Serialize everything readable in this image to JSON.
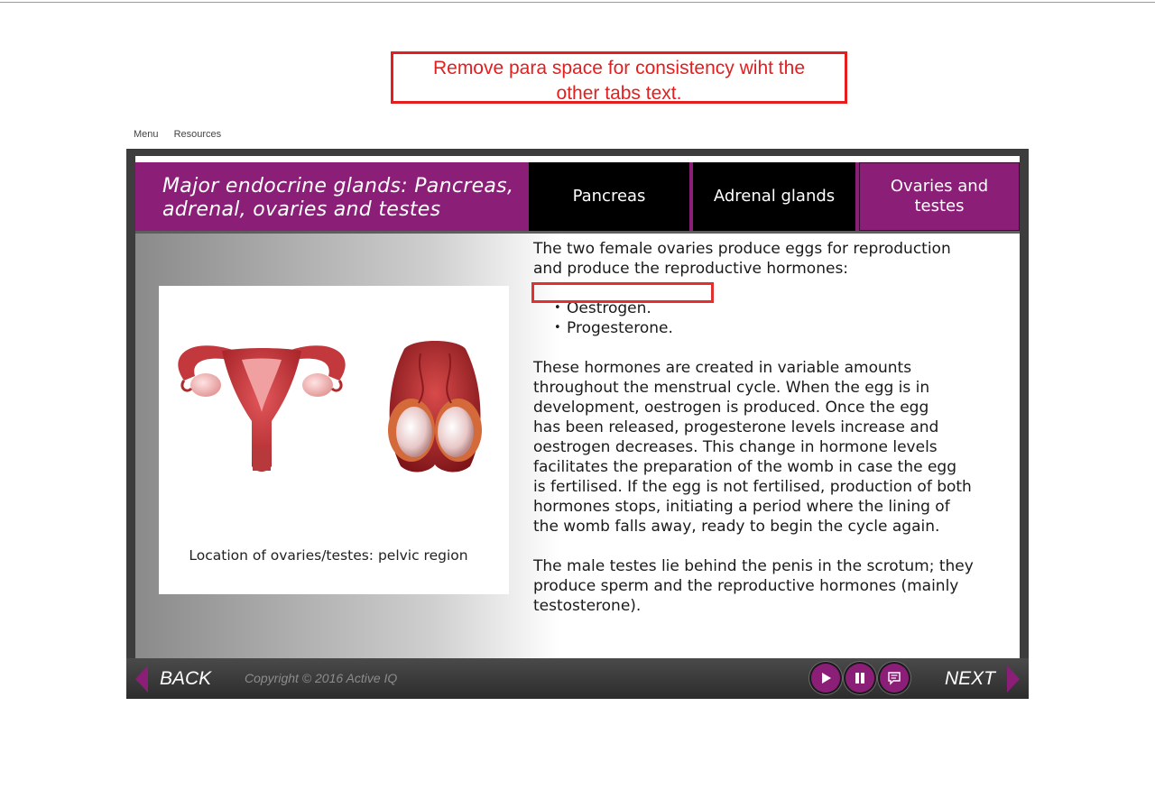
{
  "annotation": {
    "line1": "Remove para space for consistency wiht the",
    "line2": "other tabs text."
  },
  "topnav": {
    "menu": "Menu",
    "resources": "Resources"
  },
  "header": {
    "title_line1": "Major endocrine glands: Pancreas,",
    "title_line2": "adrenal, ovaries and testes",
    "tabs": [
      {
        "label": "Pancreas"
      },
      {
        "label": "Adrenal glands"
      },
      {
        "label_line1": "Ovaries and",
        "label_line2": "testes"
      }
    ]
  },
  "image": {
    "caption": "Location of ovaries/testes: pelvic region"
  },
  "content": {
    "intro_line1": "The two female ovaries produce eggs for reproduction",
    "intro_line2": "and produce the reproductive hormones:",
    "bullets": [
      "Oestrogen.",
      "Progesterone."
    ],
    "para2": [
      "These hormones are created in variable amounts",
      "throughout the menstrual cycle. When the egg is in",
      "development, oestrogen is produced. Once the egg",
      "has been released, progesterone levels increase and",
      "oestrogen decreases. This change in hormone levels",
      "facilitates the preparation of the womb in case the egg",
      "is fertilised. If the egg is not fertilised, production of both",
      "hormones stops, initiating a period where the lining of",
      "the womb falls away, ready to begin the cycle again."
    ],
    "para3": [
      "The male testes lie behind the penis in the scrotum; they",
      "produce sperm and the reproductive hormones (mainly",
      "testosterone)."
    ]
  },
  "footer": {
    "back_label": "BACK",
    "copyright": "Copyright © 2016 Active IQ",
    "next_label": "NEXT"
  },
  "colors": {
    "brand": "#8b1f78",
    "annotation_red": "#e41e1e"
  }
}
